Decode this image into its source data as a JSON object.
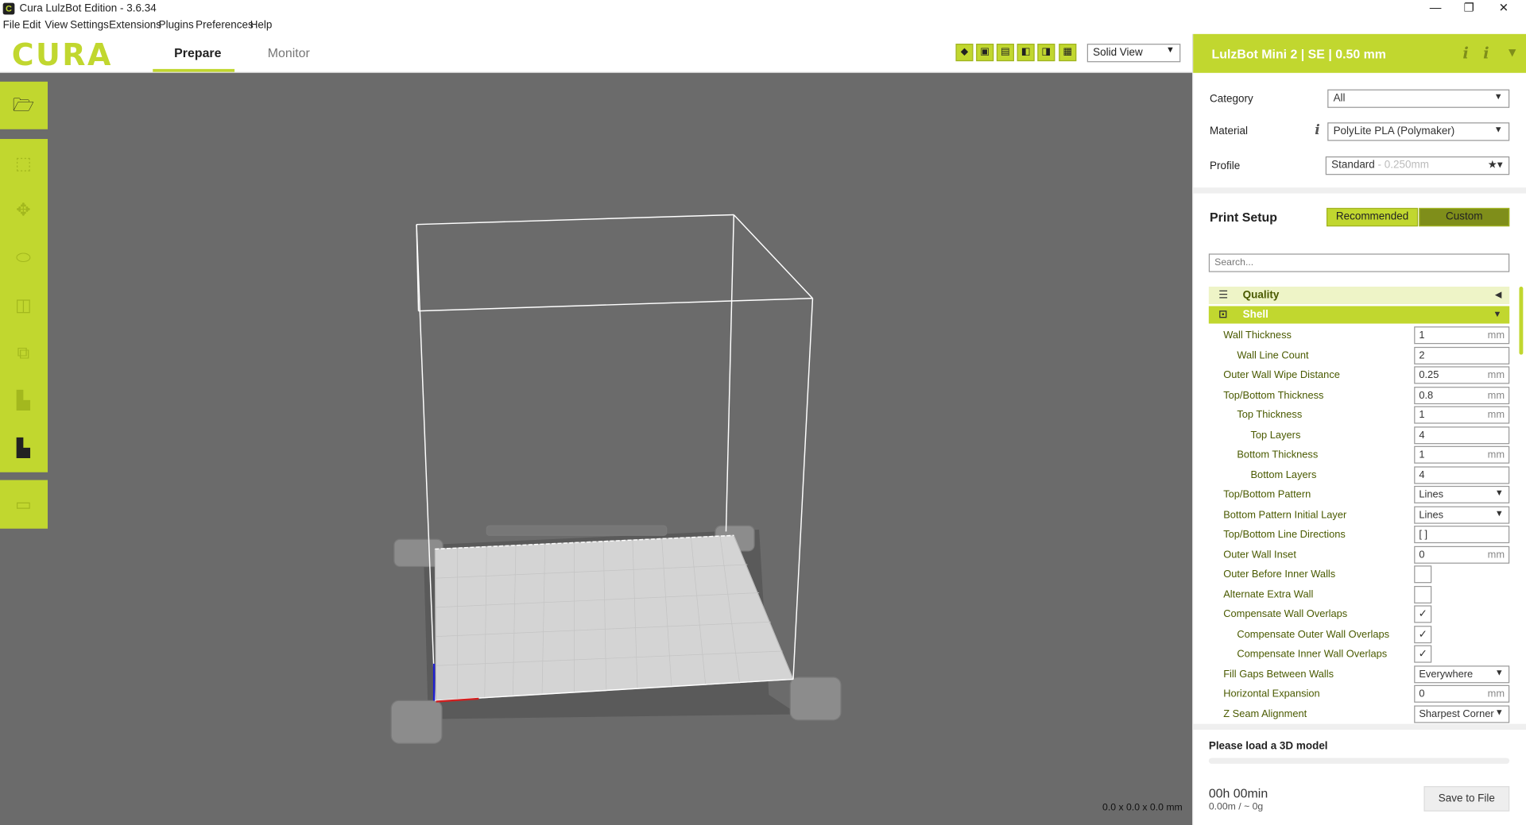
{
  "window": {
    "title": "Cura LulzBot Edition - 3.6.34",
    "icon": "C",
    "minimize": "—",
    "restore": "❐",
    "close": "✕"
  },
  "menu": [
    "File",
    "Edit",
    "View",
    "Settings",
    "Extensions",
    "Plugins",
    "Preferences",
    "Help"
  ],
  "header": {
    "logo": "CURA",
    "tabs": {
      "prepare": "Prepare",
      "monitor": "Monitor"
    },
    "view_select": "Solid View",
    "view_icons": [
      "3d-view-icon",
      "front-view-icon",
      "top-view-icon",
      "left-view-icon",
      "right-view-icon",
      "xray-view-icon"
    ]
  },
  "viewport": {
    "dimensions": "0.0 x 0.0 x 0.0 mm"
  },
  "tools": [
    "open-file-icon",
    "translate-icon",
    "move-icon",
    "scale-icon",
    "rotate-icon",
    "mirror-icon",
    "per-model-settings-icon",
    "support-blocker-icon",
    "layflat-icon"
  ],
  "panel": {
    "printer": "LulzBot Mini 2 | SE | 0.50 mm",
    "info_icon": "i",
    "labels": {
      "category": "Category",
      "material": "Material",
      "profile": "Profile"
    },
    "category": "All",
    "material": "PolyLite PLA (Polymaker)",
    "profile": "Standard",
    "profile_sub": " - 0.250mm",
    "print_setup": "Print Setup",
    "recommended": "Recommended",
    "custom": "Custom",
    "search_placeholder": "Search...",
    "categories": {
      "quality": "Quality",
      "shell": "Shell"
    },
    "settings": [
      {
        "label": "Wall Thickness",
        "indent": 0,
        "value": "1",
        "unit": "mm"
      },
      {
        "label": "Wall Line Count",
        "indent": 1,
        "value": "2",
        "unit": ""
      },
      {
        "label": "Outer Wall Wipe Distance",
        "indent": 0,
        "value": "0.25",
        "unit": "mm"
      },
      {
        "label": "Top/Bottom Thickness",
        "indent": 0,
        "value": "0.8",
        "unit": "mm"
      },
      {
        "label": "Top Thickness",
        "indent": 1,
        "value": "1",
        "unit": "mm"
      },
      {
        "label": "Top Layers",
        "indent": 2,
        "value": "4",
        "unit": ""
      },
      {
        "label": "Bottom Thickness",
        "indent": 1,
        "value": "1",
        "unit": "mm"
      },
      {
        "label": "Bottom Layers",
        "indent": 2,
        "value": "4",
        "unit": ""
      },
      {
        "label": "Top/Bottom Pattern",
        "indent": 0,
        "value": "Lines",
        "type": "select"
      },
      {
        "label": "Bottom Pattern Initial Layer",
        "indent": 0,
        "value": "Lines",
        "type": "select"
      },
      {
        "label": "Top/Bottom Line Directions",
        "indent": 0,
        "value": "[ ]",
        "unit": ""
      },
      {
        "label": "Outer Wall Inset",
        "indent": 0,
        "value": "0",
        "unit": "mm"
      },
      {
        "label": "Outer Before Inner Walls",
        "indent": 0,
        "type": "checkbox",
        "checked": false
      },
      {
        "label": "Alternate Extra Wall",
        "indent": 0,
        "type": "checkbox",
        "checked": false
      },
      {
        "label": "Compensate Wall Overlaps",
        "indent": 0,
        "type": "checkbox",
        "checked": true
      },
      {
        "label": "Compensate Outer Wall Overlaps",
        "indent": 1,
        "type": "checkbox",
        "checked": true
      },
      {
        "label": "Compensate Inner Wall Overlaps",
        "indent": 1,
        "type": "checkbox",
        "checked": true
      },
      {
        "label": "Fill Gaps Between Walls",
        "indent": 0,
        "value": "Everywhere",
        "type": "select"
      },
      {
        "label": "Horizontal Expansion",
        "indent": 0,
        "value": "0",
        "unit": "mm"
      },
      {
        "label": "Z Seam Alignment",
        "indent": 0,
        "value": "Sharpest Corner",
        "type": "select"
      }
    ],
    "footer": {
      "status": "Please load a 3D model",
      "time": "00h 00min",
      "estimate": "0.00m / ~ 0g",
      "save": "Save to File"
    }
  },
  "colors": {
    "accent": "#c1d72f",
    "viewport": "#6b6b6b",
    "custom_active": "#7f8e1a"
  }
}
